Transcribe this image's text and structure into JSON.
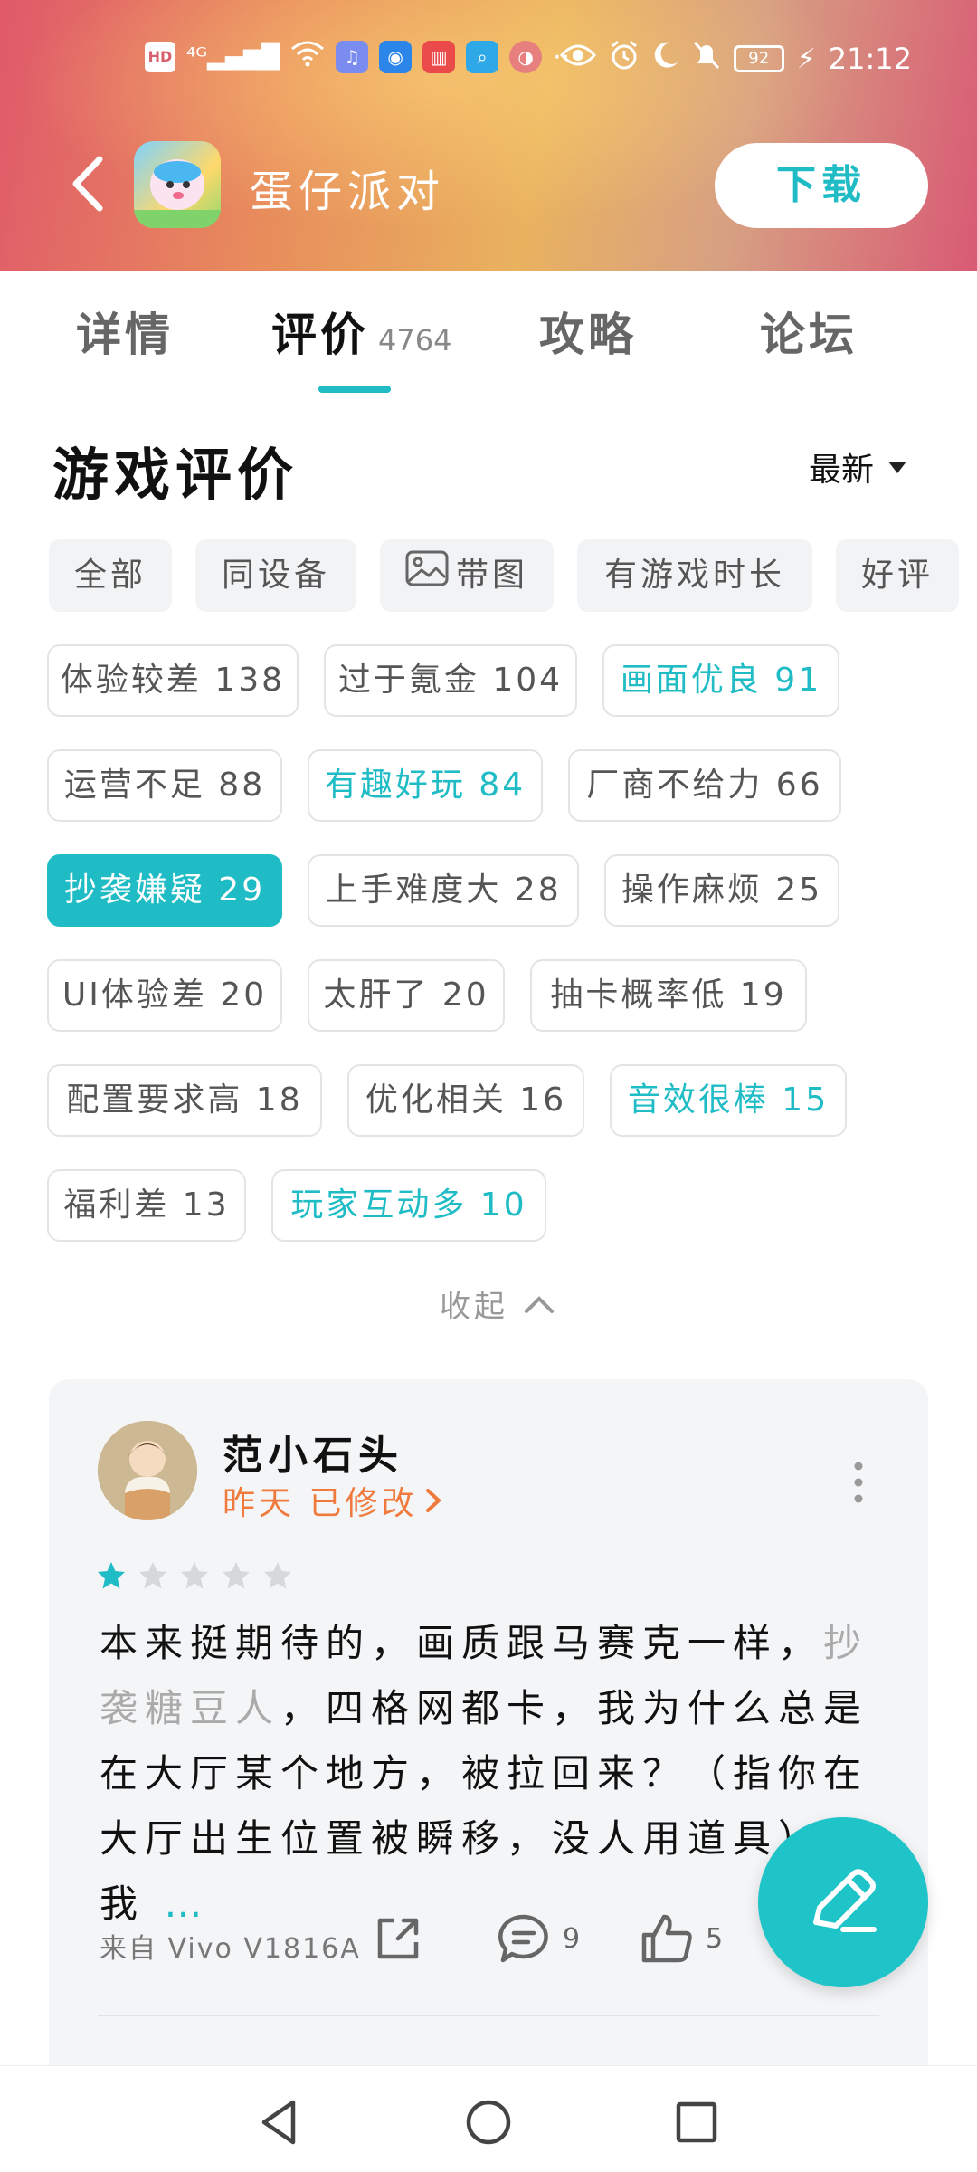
{
  "status_bar": {
    "left_icons": [
      "hd-icon",
      "4g-signal-icon",
      "wifi-icon",
      "music-app-icon",
      "bulb-app-icon",
      "book-app-icon",
      "search-app-icon",
      "ball-app-icon"
    ],
    "more": "···",
    "battery": "92",
    "time": "21:12"
  },
  "header": {
    "app_name": "蛋仔派对",
    "download_label": "下载"
  },
  "tabs": [
    {
      "label": "详情",
      "count": ""
    },
    {
      "label": "评价",
      "count": "4764"
    },
    {
      "label": "攻略",
      "count": ""
    },
    {
      "label": "论坛",
      "count": ""
    }
  ],
  "section": {
    "title": "游戏评价",
    "sort_label": "最新"
  },
  "filters": [
    "全部",
    "同设备",
    "带图",
    "有游戏时长",
    "好评"
  ],
  "tags": [
    {
      "label": "体验较差 138",
      "style": "normal"
    },
    {
      "label": "过于氪金 104",
      "style": "normal"
    },
    {
      "label": "画面优良 91",
      "style": "teal"
    },
    {
      "label": "运营不足 88",
      "style": "normal"
    },
    {
      "label": "有趣好玩 84",
      "style": "teal"
    },
    {
      "label": "厂商不给力 66",
      "style": "normal"
    },
    {
      "label": "抄袭嫌疑 29",
      "style": "active"
    },
    {
      "label": "上手难度大 28",
      "style": "normal"
    },
    {
      "label": "操作麻烦 25",
      "style": "normal"
    },
    {
      "label": "UI体验差 20",
      "style": "normal"
    },
    {
      "label": "太肝了 20",
      "style": "normal"
    },
    {
      "label": "抽卡概率低 19",
      "style": "normal"
    },
    {
      "label": "配置要求高 18",
      "style": "normal"
    },
    {
      "label": "优化相关 16",
      "style": "normal"
    },
    {
      "label": "音效很棒 15",
      "style": "teal"
    },
    {
      "label": "福利差 13",
      "style": "normal"
    },
    {
      "label": "玩家互动多 10",
      "style": "teal"
    }
  ],
  "collapse_label": "收起",
  "review": {
    "username": "范小石头",
    "meta": "昨天 已修改",
    "rating": 1,
    "rating_max": 5,
    "text_part1": "本来挺期待的，画质跟马赛克一样，",
    "text_highlight": "抄袭糖豆人",
    "text_part2": "，四格网都卡，我为什么总是在大厅某个地方，被拉回来？（指你在大厅出生位置被瞬移，没人用道具），我",
    "text_ellipsis": "…",
    "source": "来自 Vivo V1816A",
    "comments": "9",
    "likes": "5"
  },
  "colors": {
    "accent": "#1fbcc6",
    "meta_orange": "#f07a3d"
  }
}
